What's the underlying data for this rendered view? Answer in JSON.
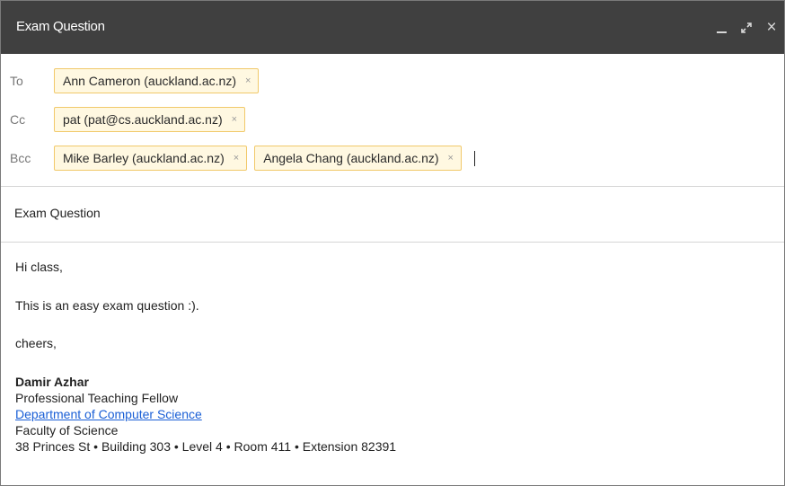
{
  "window": {
    "title": "Exam Question",
    "controls": [
      "minimize-icon",
      "expand-icon",
      "close-icon"
    ],
    "controls_glyphs": {
      "minimize": "_",
      "expand": "⤢",
      "close": "×"
    }
  },
  "recipients": {
    "to_label": "To",
    "cc_label": "Cc",
    "bcc_label": "Bcc",
    "to": [
      {
        "name": "Ann Cameron (auckland.ac.nz)",
        "remove": "×"
      }
    ],
    "cc": [
      {
        "name": "pat (pat@cs.auckland.ac.nz)",
        "remove": "×"
      }
    ],
    "bcc": [
      {
        "name": "Mike Barley (auckland.ac.nz)",
        "remove": "×"
      },
      {
        "name": "Angela Chang (auckland.ac.nz)",
        "remove": "×"
      }
    ]
  },
  "subject": "Exam Question",
  "body": {
    "greeting": "Hi class,",
    "message": "This is an easy exam question :).",
    "closing": "cheers,"
  },
  "signature": {
    "name": "Damir Azhar",
    "role": "Professional Teaching Fellow",
    "department_link": "Department of Computer Science",
    "faculty": "Faculty of Science",
    "address": "38 Princes St •  Building 303 • Level 4 • Room 411 • Extension 82391"
  },
  "colors": {
    "titlebar": "#404040",
    "chip_border": "#f1c96a",
    "chip_background": "#fff8e1",
    "link": "#1a5fd6"
  }
}
